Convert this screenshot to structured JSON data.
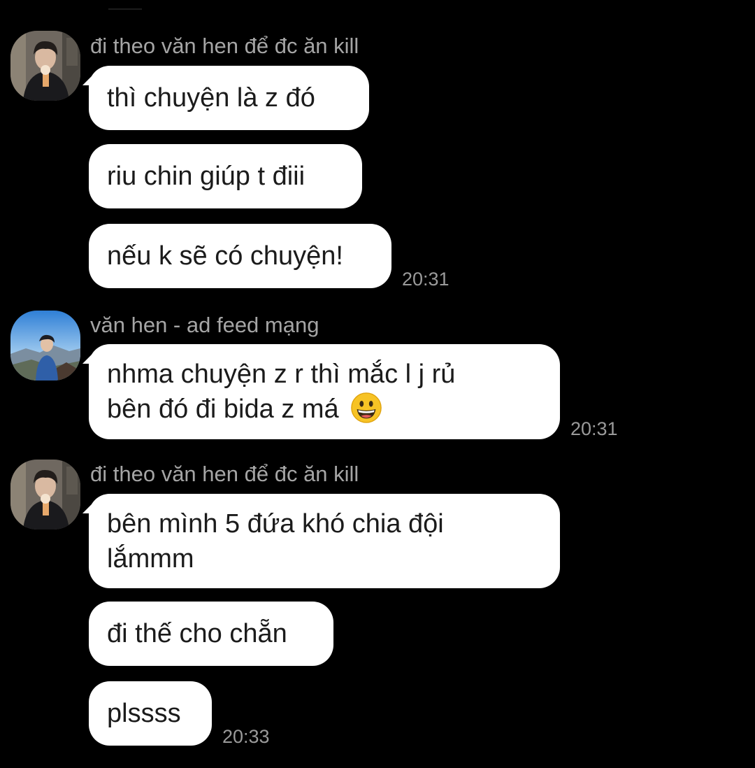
{
  "colors": {
    "background": "#000000",
    "bubble": "#ffffff",
    "bubble_text": "#1b1b1b",
    "sender_name": "#a5a5a5",
    "timestamp": "#9a9a9a"
  },
  "chat": {
    "groups": [
      {
        "sender": "đi theo văn hen để đc ăn kill",
        "avatar_icon": "avatar-boy-ice-cream",
        "time": "20:31",
        "messages": [
          {
            "lines": [
              "thì chuyện là z đó"
            ]
          },
          {
            "lines": [
              "riu chin giúp t điii"
            ]
          },
          {
            "lines": [
              "nếu k sẽ có chuyện!"
            ]
          }
        ]
      },
      {
        "sender": "văn hen - ad feed mạng",
        "avatar_icon": "avatar-girl-mountain",
        "time": "20:31",
        "messages": [
          {
            "lines": [
              "nhma chuyện z r thì mắc l j rủ",
              "bên đó đi bida z má"
            ],
            "emoji": "grinning-face-emoji"
          }
        ]
      },
      {
        "sender": "đi theo văn hen để đc ăn kill",
        "avatar_icon": "avatar-boy-ice-cream",
        "time": "20:33",
        "messages": [
          {
            "lines": [
              "bên mình 5 đứa khó chia đội",
              "lắmmm"
            ]
          },
          {
            "lines": [
              "đi thế cho chẵn"
            ]
          },
          {
            "lines": [
              "plssss"
            ]
          }
        ]
      }
    ]
  }
}
